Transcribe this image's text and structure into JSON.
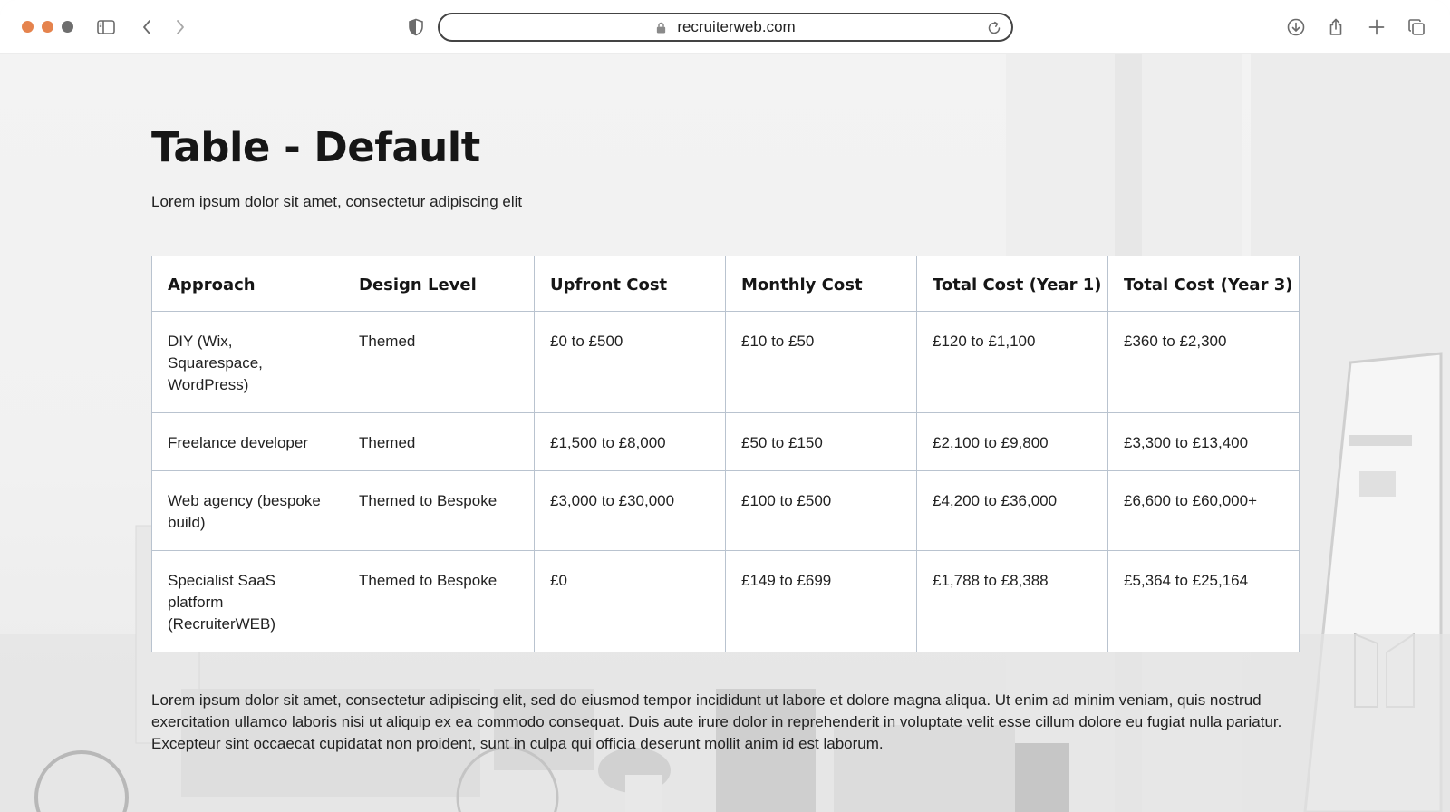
{
  "browser": {
    "url": "recruiterweb.com",
    "colors": {
      "traffic_close": "#e5834d",
      "traffic_min": "#e5834d",
      "traffic_max": "#6e6e6e"
    },
    "icons": [
      "sidebar-icon",
      "back-icon",
      "forward-icon",
      "shield-icon",
      "lock-icon",
      "reload-icon",
      "download-icon",
      "share-icon",
      "new-tab-icon",
      "tabs-overview-icon"
    ]
  },
  "page": {
    "title": "Table - Default",
    "subtitle": "Lorem ipsum dolor sit amet, consectetur adipiscing elit",
    "table": {
      "headers": [
        "Approach",
        "Design Level",
        "Upfront Cost",
        "Monthly Cost",
        "Total Cost (Year 1)",
        "Total Cost (Year 3)"
      ],
      "rows": [
        [
          "DIY (Wix, Squarespace, WordPress)",
          "Themed",
          "£0 to £500",
          "£10 to £50",
          "£120 to £1,100",
          "£360 to £2,300"
        ],
        [
          "Freelance developer",
          "Themed",
          "£1,500 to £8,000",
          "£50 to £150",
          "£2,100 to £9,800",
          "£3,300 to £13,400"
        ],
        [
          "Web agency (bespoke build)",
          "Themed to Bespoke",
          "£3,000 to £30,000",
          "£100 to £500",
          "£4,200 to £36,000",
          "£6,600 to £60,000+"
        ],
        [
          "Specialist SaaS platform (RecruiterWEB)",
          "Themed to Bespoke",
          "£0",
          "£149 to £699",
          "£1,788 to £8,388",
          "£5,364 to £25,164"
        ]
      ]
    },
    "body": "Lorem ipsum dolor sit amet, consectetur adipiscing elit, sed do eiusmod tempor incididunt ut labore et dolore magna aliqua. Ut enim ad minim veniam, quis nostrud exercitation ullamco laboris nisi ut aliquip ex ea commodo consequat. Duis aute irure dolor in reprehenderit in voluptate velit esse cillum dolore eu fugiat nulla pariatur. Excepteur sint occaecat cupidatat non proident, sunt in culpa qui officia deserunt mollit anim id est laborum."
  }
}
